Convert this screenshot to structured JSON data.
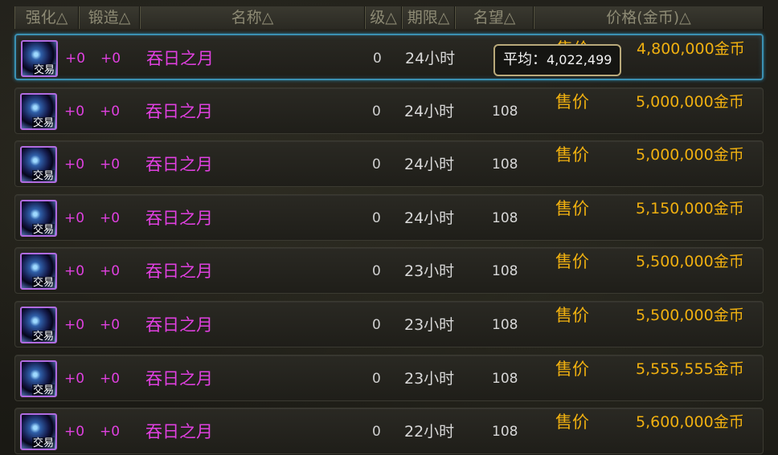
{
  "header": {
    "columns": [
      {
        "key": "strengthen",
        "label": "强化△"
      },
      {
        "key": "forge",
        "label": "锻造△"
      },
      {
        "key": "name",
        "label": "名称△"
      },
      {
        "key": "level",
        "label": "级△"
      },
      {
        "key": "duration",
        "label": "期限△"
      },
      {
        "key": "fame",
        "label": "名望△"
      },
      {
        "key": "price",
        "label": "价格(金币)△"
      }
    ]
  },
  "tooltip": {
    "label": "平均：",
    "value": "4,022,499"
  },
  "listings": [
    {
      "badge": "交易",
      "strengthen": "+0",
      "forge": "+0",
      "name": "吞日之月",
      "level": "0",
      "duration": "24小时",
      "fame": "",
      "sale_label": "售价",
      "price": "4,800,000金币",
      "selected": true
    },
    {
      "badge": "交易",
      "strengthen": "+0",
      "forge": "+0",
      "name": "吞日之月",
      "level": "0",
      "duration": "24小时",
      "fame": "108",
      "sale_label": "售价",
      "price": "5,000,000金币"
    },
    {
      "badge": "交易",
      "strengthen": "+0",
      "forge": "+0",
      "name": "吞日之月",
      "level": "0",
      "duration": "24小时",
      "fame": "108",
      "sale_label": "售价",
      "price": "5,000,000金币"
    },
    {
      "badge": "交易",
      "strengthen": "+0",
      "forge": "+0",
      "name": "吞日之月",
      "level": "0",
      "duration": "24小时",
      "fame": "108",
      "sale_label": "售价",
      "price": "5,150,000金币"
    },
    {
      "badge": "交易",
      "strengthen": "+0",
      "forge": "+0",
      "name": "吞日之月",
      "level": "0",
      "duration": "23小时",
      "fame": "108",
      "sale_label": "售价",
      "price": "5,500,000金币"
    },
    {
      "badge": "交易",
      "strengthen": "+0",
      "forge": "+0",
      "name": "吞日之月",
      "level": "0",
      "duration": "23小时",
      "fame": "108",
      "sale_label": "售价",
      "price": "5,500,000金币"
    },
    {
      "badge": "交易",
      "strengthen": "+0",
      "forge": "+0",
      "name": "吞日之月",
      "level": "0",
      "duration": "23小时",
      "fame": "108",
      "sale_label": "售价",
      "price": "5,555,555金币"
    },
    {
      "badge": "交易",
      "strengthen": "+0",
      "forge": "+0",
      "name": "吞日之月",
      "level": "0",
      "duration": "22小时",
      "fame": "108",
      "sale_label": "售价",
      "price": "5,600,000金币"
    }
  ],
  "colors": {
    "name_text": "#e040e0",
    "price_text": "#f0b010",
    "selected_border": "#3b90b2",
    "header_text": "#8d8a74"
  }
}
